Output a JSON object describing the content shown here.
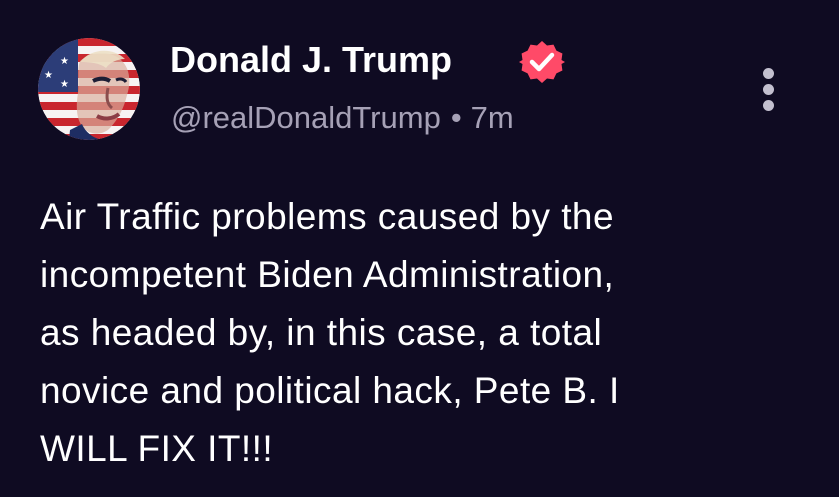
{
  "author": {
    "display_name": "Donald J. Trump",
    "handle": "@realDonaldTrump",
    "separator": "•",
    "time_ago": "7m",
    "verified_color": "#ff4a68"
  },
  "post": {
    "lines": [
      "Air Traffic problems caused by the",
      "incompetent Biden Administration,",
      "as headed by, in this case, a total",
      "novice and political hack, Pete B. I",
      "WILL FIX IT!!!"
    ]
  },
  "icons": {
    "avatar": "flag-portrait-avatar",
    "verified": "verified-badge-icon",
    "more": "more-vertical-icon"
  },
  "theme": {
    "background": "#0f0b22",
    "text": "#ffffff",
    "secondary_text": "#a6a1b6"
  }
}
